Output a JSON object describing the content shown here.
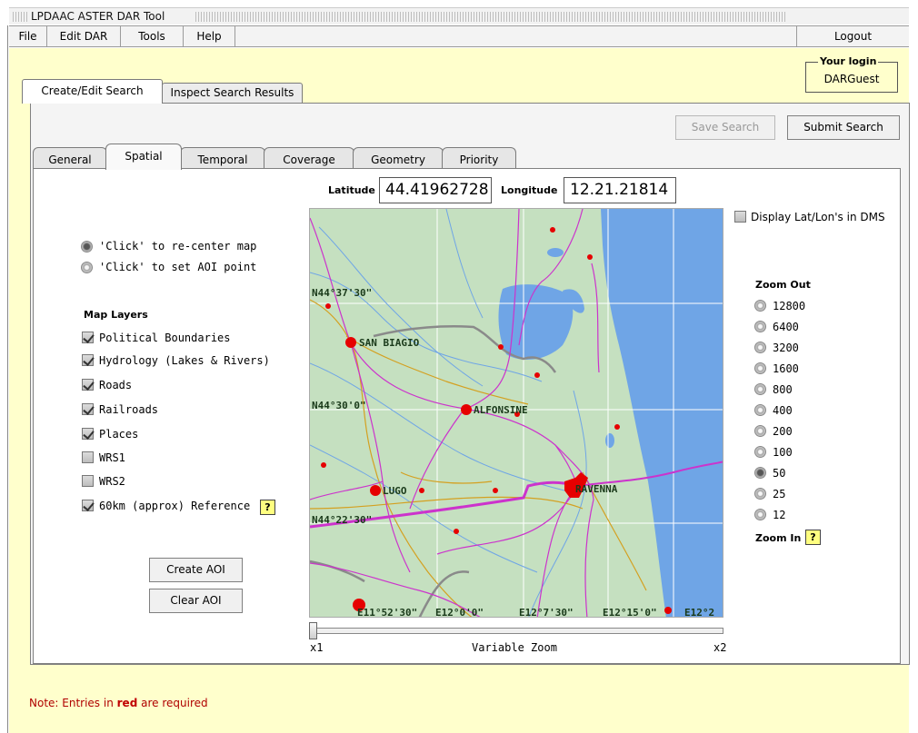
{
  "window": {
    "title": "LPDAAC ASTER DAR Tool"
  },
  "menu": {
    "items": [
      "File",
      "Edit DAR",
      "Tools",
      "Help"
    ],
    "logout": "Logout"
  },
  "login": {
    "title": "Your login",
    "user": "DARGuest"
  },
  "main_tabs": [
    "Create/Edit Search",
    "Inspect Search Results"
  ],
  "actions": {
    "save": "Save Search",
    "submit": "Submit Search"
  },
  "sub_tabs": [
    "General",
    "Spatial",
    "Temporal",
    "Coverage",
    "Geometry",
    "Priority"
  ],
  "coords": {
    "lat_label": "Latitude",
    "lat_value": "44.41962728",
    "lon_label": "Longitude",
    "lon_value": "12.21.21814"
  },
  "dms": {
    "label": "Display Lat/Lon's in DMS",
    "checked": false
  },
  "click_modes": [
    {
      "label": "'Click' to re-center map",
      "selected": true
    },
    {
      "label": "'Click' to set AOI point",
      "selected": false
    }
  ],
  "layers": {
    "title": "Map Layers",
    "items": [
      {
        "label": "Political Boundaries",
        "checked": true
      },
      {
        "label": "Hydrology (Lakes & Rivers)",
        "checked": true
      },
      {
        "label": "Roads",
        "checked": true
      },
      {
        "label": "Railroads",
        "checked": true
      },
      {
        "label": "Places",
        "checked": true
      },
      {
        "label": "WRS1",
        "checked": false
      },
      {
        "label": "WRS2",
        "checked": false
      },
      {
        "label": "60km (approx) Reference",
        "checked": true
      }
    ],
    "help": "?"
  },
  "aoi": {
    "create": "Create AOI",
    "clear": "Clear AOI"
  },
  "zoom": {
    "out_label": "Zoom Out",
    "in_label": "Zoom In",
    "help": "?",
    "levels": [
      "12800",
      "6400",
      "3200",
      "1600",
      "800",
      "400",
      "200",
      "100",
      "50",
      "25",
      "12"
    ],
    "selected": "50"
  },
  "map": {
    "lat_labels": [
      "N44°37'30\"",
      "N44°30'0\"",
      "N44°22'30\""
    ],
    "lon_labels": [
      "E11°52'30\"",
      "E12°0'0\"",
      "E12°7'30\"",
      "E12°15'0\"",
      "E12°2"
    ],
    "places": [
      "SAN BIAGIO",
      "ALFONSINE",
      "LUGO",
      "RAVENNA"
    ],
    "colors": {
      "land": "#c5e0c0",
      "water": "#6fa5e6",
      "roads": "#cc33cc",
      "rivers": "#6fa5e6",
      "boundaries": "#d4a020",
      "railroads": "#888888",
      "places": "#e60000",
      "grid": "#ffffff"
    }
  },
  "variable_zoom": {
    "label": "Variable Zoom",
    "min": "x1",
    "max": "x2",
    "value": 0
  },
  "note": {
    "prefix": "Note: Entries in ",
    "bold": "red",
    "suffix": " are required"
  }
}
